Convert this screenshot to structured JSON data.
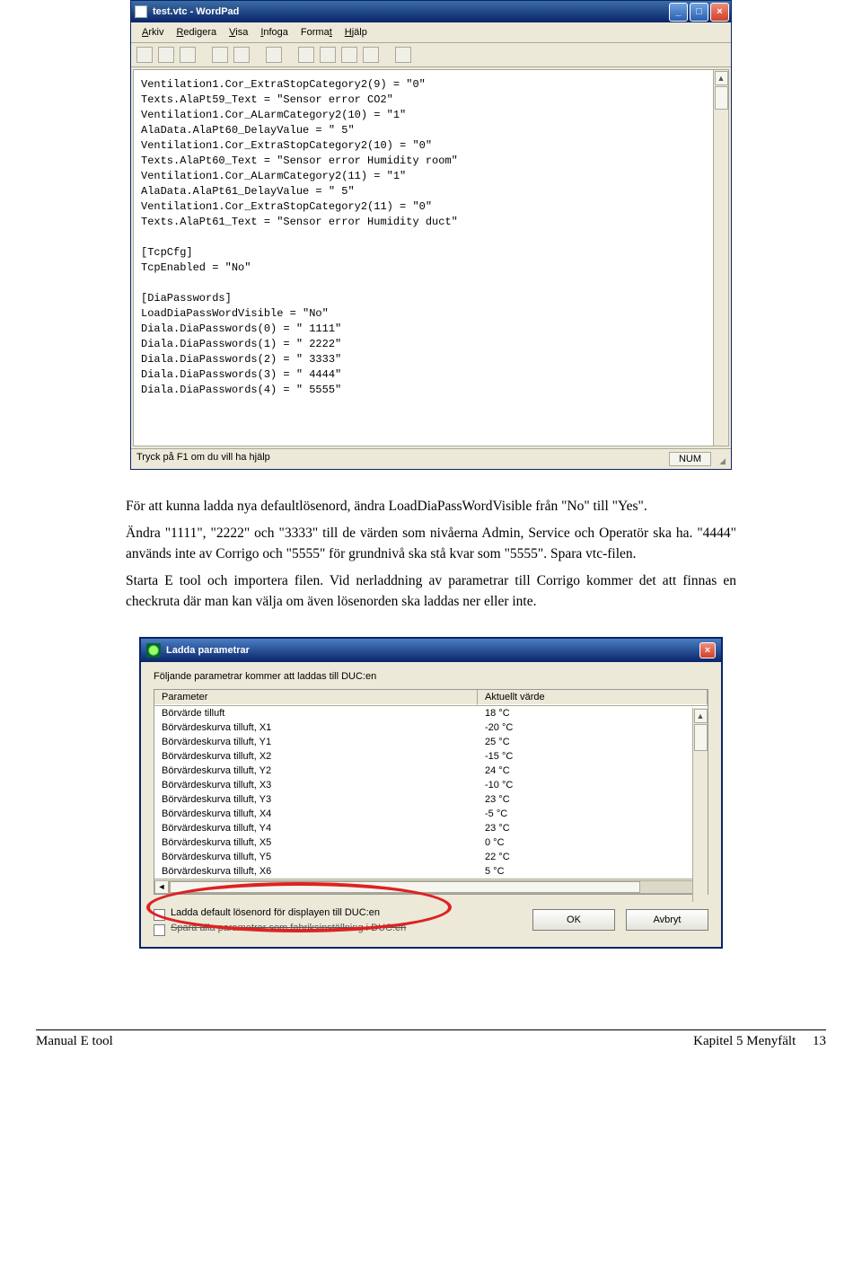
{
  "wordpad": {
    "title": "test.vtc - WordPad",
    "menu": [
      "Arkiv",
      "Redigera",
      "Visa",
      "Infoga",
      "Format",
      "Hjälp"
    ],
    "lines": [
      "Ventilation1.Cor_ExtraStopCategory2(9) = \"0\"",
      "Texts.AlaPt59_Text = \"Sensor error CO2\"",
      "Ventilation1.Cor_ALarmCategory2(10) = \"1\"",
      "AlaData.AlaPt60_DelayValue = \" 5\"",
      "Ventilation1.Cor_ExtraStopCategory2(10) = \"0\"",
      "Texts.AlaPt60_Text = \"Sensor error Humidity room\"",
      "Ventilation1.Cor_ALarmCategory2(11) = \"1\"",
      "AlaData.AlaPt61_DelayValue = \" 5\"",
      "Ventilation1.Cor_ExtraStopCategory2(11) = \"0\"",
      "Texts.AlaPt61_Text = \"Sensor error Humidity duct\"",
      "",
      "[TcpCfg]",
      "TcpEnabled = \"No\"",
      "",
      "[DiaPasswords]",
      "LoadDiaPassWordVisible = \"No\"",
      "Diala.DiaPasswords(0) = \" 1111\"",
      "Diala.DiaPasswords(1) = \" 2222\"",
      "Diala.DiaPasswords(2) = \" 3333\"",
      "Diala.DiaPasswords(3) = \" 4444\"",
      "Diala.DiaPasswords(4) = \" 5555\""
    ],
    "status_left": "Tryck på F1 om du vill ha hjälp",
    "status_right": "NUM"
  },
  "body": {
    "p1": "För att kunna ladda nya defaultlösenord, ändra LoadDiaPassWordVisible från \"No\" till \"Yes\".",
    "p2": "Ändra \"1111\", \"2222\" och \"3333\" till de värden som nivåerna Admin, Service och Operatör ska ha. \"4444\" används inte av Corrigo och \"5555\" för grundnivå ska stå kvar som \"5555\". Spara vtc-filen.",
    "p3": "Starta E tool och importera filen. Vid nerladdning av parametrar till Corrigo kommer det att finnas en checkruta där man kan välja om även lösenorden ska laddas ner eller inte."
  },
  "dialog": {
    "title": "Ladda parametrar",
    "intro": "Följande parametrar kommer att laddas till DUC:en",
    "header_param": "Parameter",
    "header_value": "Aktuellt värde",
    "rows": [
      {
        "p": "Börvärde tilluft",
        "v": "18 °C"
      },
      {
        "p": "Börvärdeskurva tilluft, X1",
        "v": "-20 °C"
      },
      {
        "p": "Börvärdeskurva tilluft, Y1",
        "v": "25 °C"
      },
      {
        "p": "Börvärdeskurva tilluft, X2",
        "v": "-15 °C"
      },
      {
        "p": "Börvärdeskurva tilluft, Y2",
        "v": "24 °C"
      },
      {
        "p": "Börvärdeskurva tilluft, X3",
        "v": "-10 °C"
      },
      {
        "p": "Börvärdeskurva tilluft, Y3",
        "v": "23 °C"
      },
      {
        "p": "Börvärdeskurva tilluft, X4",
        "v": "-5 °C"
      },
      {
        "p": "Börvärdeskurva tilluft, Y4",
        "v": "23 °C"
      },
      {
        "p": "Börvärdeskurva tilluft, X5",
        "v": "0 °C"
      },
      {
        "p": "Börvärdeskurva tilluft, Y5",
        "v": "22 °C"
      },
      {
        "p": "Börvärdeskurva tilluft, X6",
        "v": "5 °C"
      }
    ],
    "chk1": "Ladda default lösenord för displayen till DUC:en",
    "chk2": "Spara alla parametrar som fabriksinställning i DUC:en",
    "ok": "OK",
    "cancel": "Avbryt"
  },
  "footer": {
    "left": "Manual E tool",
    "right_chapter": "Kapitel 5   Menyfält",
    "right_page": "13"
  }
}
